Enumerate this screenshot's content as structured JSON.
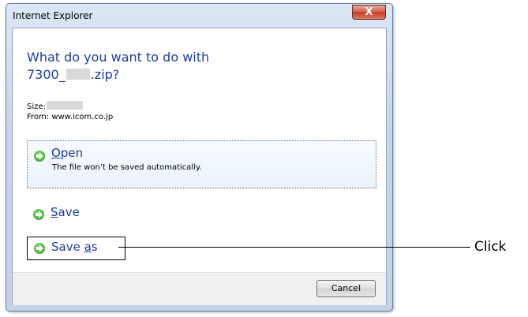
{
  "window": {
    "title": "Internet Explorer",
    "close_glyph": "X"
  },
  "prompt": {
    "line1": "What do you want to do with",
    "filename_prefix": "7300_",
    "filename_suffix": ".zip?"
  },
  "details": {
    "size_label": "Size:",
    "from_label": "From: www.icom.co.jp"
  },
  "options": {
    "open": {
      "label_first": "O",
      "label_rest": "pen",
      "description": "The file won’t be saved automatically."
    },
    "save": {
      "label_first": "S",
      "label_rest": "ave"
    },
    "save_as": {
      "label_before": "Save ",
      "label_underlined": "a",
      "label_after": "s"
    }
  },
  "footer": {
    "cancel_label": "Cancel"
  },
  "annotation": {
    "label": "Click"
  }
}
